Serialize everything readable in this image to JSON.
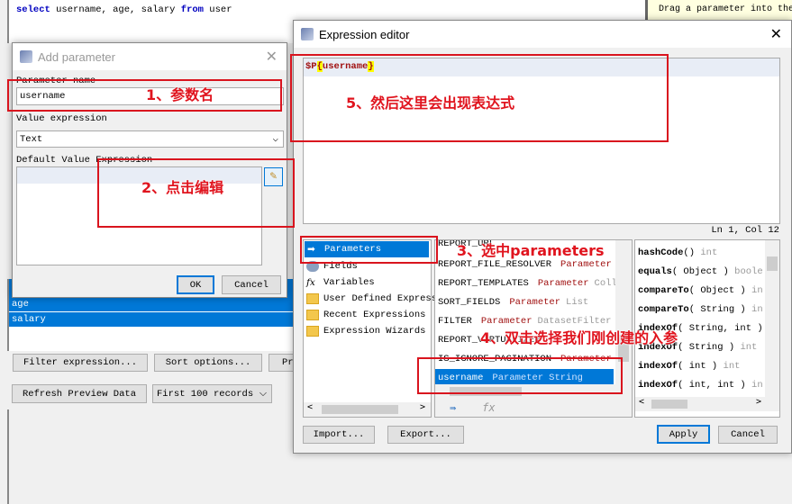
{
  "sql": {
    "kw_select": "select",
    "cols": "username, age, salary",
    "kw_from": "from",
    "table": "user"
  },
  "hint": "Drag a parameter into the",
  "fields": [
    "age",
    "salary"
  ],
  "buttons": {
    "filter": "Filter expression...",
    "sort": "Sort options...",
    "preview_cut": "Pr",
    "refresh": "Refresh Preview Data",
    "records": "First 100 records"
  },
  "add_param": {
    "title": "Add parameter",
    "name_label": "Parameter name",
    "name_value": "username",
    "value_expr_label": "Value expression",
    "value_expr_value": "Text",
    "default_label": "Default Value Expression",
    "ok": "OK",
    "cancel": "Cancel"
  },
  "expr": {
    "title": "Expression editor",
    "text_p": "$P",
    "text_open": "{",
    "text_name": "username",
    "text_close": "}",
    "status": "Ln 1, Col 12",
    "categories": [
      {
        "label": "Parameters",
        "icon": "parameter-icon"
      },
      {
        "label": "Fields",
        "icon": "database-icon"
      },
      {
        "label": "Variables",
        "icon": "function-icon"
      },
      {
        "label": "User Defined Express",
        "icon": "folder-icon"
      },
      {
        "label": "Recent Expressions",
        "icon": "folder-icon"
      },
      {
        "label": "Expression Wizards",
        "icon": "folder-icon"
      }
    ],
    "params": [
      {
        "name": "REPORT_URL",
        "kind": "Parameter",
        "type": ""
      },
      {
        "name": "REPORT_FILE_RESOLVER",
        "kind": "Parameter",
        "type": ""
      },
      {
        "name": "REPORT_TEMPLATES",
        "kind": "Parameter",
        "type": "Coll"
      },
      {
        "name": "SORT_FIELDS",
        "kind": "Parameter",
        "type": "List"
      },
      {
        "name": "FILTER",
        "kind": "Parameter",
        "type": "DatasetFilter"
      },
      {
        "name": "REPORT_VIRTUALIZER",
        "kind": "",
        "type": ""
      },
      {
        "name": "IS_IGNORE_PAGINATION",
        "kind": "Parameter",
        "type": ""
      },
      {
        "name": "username",
        "kind": "Parameter",
        "type": "String"
      }
    ],
    "methods": [
      {
        "name": "hashCode",
        "args": "()",
        "ret": "int"
      },
      {
        "name": "equals",
        "args": "( Object )",
        "ret": "boole"
      },
      {
        "name": "compareTo",
        "args": "( Object )",
        "ret": "in"
      },
      {
        "name": "compareTo",
        "args": "( String )",
        "ret": "in"
      },
      {
        "name": "indexOf",
        "args": "( String, int )",
        "ret": ""
      },
      {
        "name": "indexOf",
        "args": "( String )",
        "ret": "int"
      },
      {
        "name": "indexOf",
        "args": "( int )",
        "ret": "int"
      },
      {
        "name": "indexOf",
        "args": "( int, int )",
        "ret": "in"
      }
    ],
    "import": "Import...",
    "export": "Export...",
    "apply": "Apply",
    "cancel": "Cancel"
  },
  "annotations": {
    "a1": "1、参数名",
    "a2": "2、点击编辑",
    "a3": "3、选中parameters",
    "a4": "4、双击选择我们刚创建的入参",
    "a5": "5、然后这里会出现表达式"
  },
  "colors": {
    "accent": "#0078d7",
    "annotation": "#e0141e",
    "parameter_kind": "#a01010"
  }
}
